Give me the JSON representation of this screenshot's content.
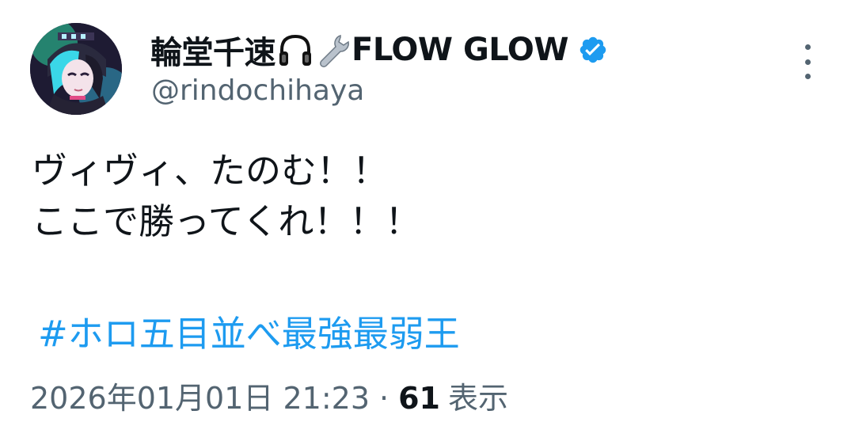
{
  "author": {
    "display_name": "輪堂千速",
    "display_name_suffix": "FLOW GLOW",
    "name_emojis": [
      "headphone-icon",
      "wrench-icon"
    ],
    "handle": "@rindochihaya",
    "verified": true,
    "verified_color": "#1d9bf0"
  },
  "tweet": {
    "lines": [
      "ヴィヴィ、たのむ！！",
      "ここで勝ってくれ！！！"
    ],
    "hashtag": "#ホロ五目並べ最強最弱王"
  },
  "meta": {
    "timestamp": "2026年01月01日 21:23",
    "separator": "·",
    "views_count": "61",
    "views_label": "表示"
  },
  "colors": {
    "text": "#0f1419",
    "secondary": "#536471",
    "link": "#1d9bf0"
  }
}
